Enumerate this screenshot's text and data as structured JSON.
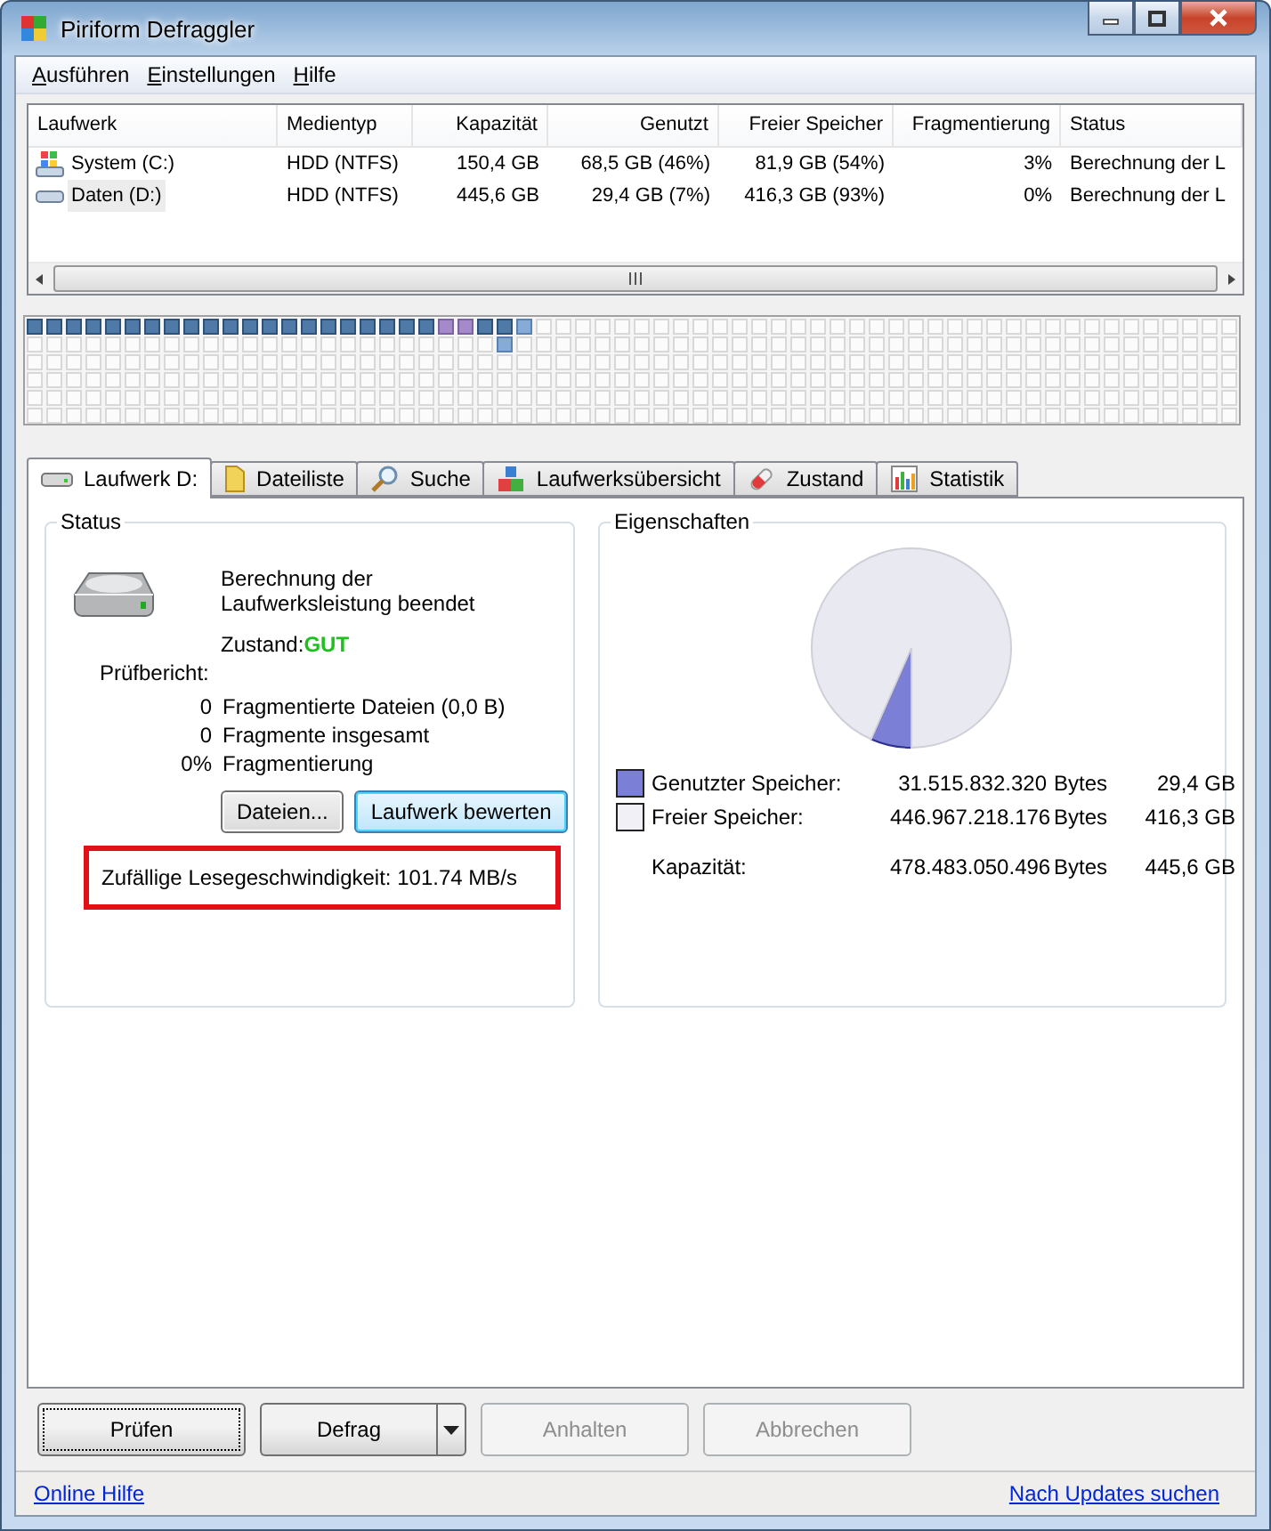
{
  "window": {
    "title": "Piriform Defraggler"
  },
  "menu": [
    {
      "label": "Ausführen"
    },
    {
      "label": "Einstellungen"
    },
    {
      "label": "Hilfe"
    }
  ],
  "drives": {
    "columns": [
      {
        "label": "Laufwerk"
      },
      {
        "label": "Medientyp"
      },
      {
        "label": "Kapazität"
      },
      {
        "label": "Genutzt"
      },
      {
        "label": "Freier Speicher"
      },
      {
        "label": "Fragmentierung"
      },
      {
        "label": "Status"
      }
    ],
    "rows": [
      {
        "kind": "system",
        "selected": false,
        "cells": [
          "System (C:)",
          "HDD (NTFS)",
          "150,4 GB",
          "68,5 GB (46%)",
          "81,9 GB (54%)",
          "3%",
          "Berechnung der L"
        ]
      },
      {
        "kind": "data",
        "selected": true,
        "cells": [
          "Daten (D:)",
          "HDD (NTFS)",
          "445,6 GB",
          "29,4 GB (7%)",
          "416,3 GB (93%)",
          "0%",
          "Berechnung der L"
        ]
      }
    ]
  },
  "cluster_map": {
    "rows": [
      {
        "blocks": [
          {
            "kind": "used"
          },
          {
            "kind": "used"
          },
          {
            "kind": "used"
          },
          {
            "kind": "used"
          },
          {
            "kind": "used"
          },
          {
            "kind": "used"
          },
          {
            "kind": "used"
          },
          {
            "kind": "used"
          },
          {
            "kind": "used"
          },
          {
            "kind": "used"
          },
          {
            "kind": "used"
          },
          {
            "kind": "used"
          },
          {
            "kind": "used"
          },
          {
            "kind": "used"
          },
          {
            "kind": "used"
          },
          {
            "kind": "used"
          },
          {
            "kind": "used"
          },
          {
            "kind": "used"
          },
          {
            "kind": "used"
          },
          {
            "kind": "used"
          },
          {
            "kind": "used"
          },
          {
            "kind": "fragmented"
          },
          {
            "kind": "fragmented"
          },
          {
            "kind": "used"
          },
          {
            "kind": "used"
          },
          {
            "kind": "current"
          },
          {
            "kind": "free"
          },
          {
            "kind": "free"
          },
          {
            "kind": "free"
          },
          {
            "kind": "free"
          },
          {
            "kind": "free"
          },
          {
            "kind": "free"
          },
          {
            "kind": "free"
          },
          {
            "kind": "free"
          },
          {
            "kind": "free"
          },
          {
            "kind": "free"
          },
          {
            "kind": "free"
          },
          {
            "kind": "free"
          },
          {
            "kind": "free"
          },
          {
            "kind": "free"
          },
          {
            "kind": "free"
          },
          {
            "kind": "free"
          },
          {
            "kind": "free"
          },
          {
            "kind": "free"
          },
          {
            "kind": "free"
          },
          {
            "kind": "free"
          },
          {
            "kind": "free"
          },
          {
            "kind": "free"
          },
          {
            "kind": "free"
          },
          {
            "kind": "free"
          },
          {
            "kind": "free"
          },
          {
            "kind": "free"
          },
          {
            "kind": "free"
          },
          {
            "kind": "free"
          },
          {
            "kind": "free"
          },
          {
            "kind": "free"
          },
          {
            "kind": "free"
          },
          {
            "kind": "free"
          },
          {
            "kind": "free"
          },
          {
            "kind": "free"
          },
          {
            "kind": "free"
          },
          {
            "kind": "free"
          }
        ]
      },
      {
        "blocks": [
          {
            "kind": "free"
          },
          {
            "kind": "free"
          },
          {
            "kind": "free"
          },
          {
            "kind": "free"
          },
          {
            "kind": "free"
          },
          {
            "kind": "free"
          },
          {
            "kind": "free"
          },
          {
            "kind": "free"
          },
          {
            "kind": "free"
          },
          {
            "kind": "free"
          },
          {
            "kind": "free"
          },
          {
            "kind": "free"
          },
          {
            "kind": "free"
          },
          {
            "kind": "free"
          },
          {
            "kind": "free"
          },
          {
            "kind": "free"
          },
          {
            "kind": "free"
          },
          {
            "kind": "free"
          },
          {
            "kind": "free"
          },
          {
            "kind": "free"
          },
          {
            "kind": "free"
          },
          {
            "kind": "free"
          },
          {
            "kind": "free"
          },
          {
            "kind": "free"
          },
          {
            "kind": "current"
          },
          {
            "kind": "free"
          },
          {
            "kind": "free"
          },
          {
            "kind": "free"
          },
          {
            "kind": "free"
          },
          {
            "kind": "free"
          },
          {
            "kind": "free"
          },
          {
            "kind": "free"
          },
          {
            "kind": "free"
          },
          {
            "kind": "free"
          },
          {
            "kind": "free"
          },
          {
            "kind": "free"
          },
          {
            "kind": "free"
          },
          {
            "kind": "free"
          },
          {
            "kind": "free"
          },
          {
            "kind": "free"
          },
          {
            "kind": "free"
          },
          {
            "kind": "free"
          },
          {
            "kind": "free"
          },
          {
            "kind": "free"
          },
          {
            "kind": "free"
          },
          {
            "kind": "free"
          },
          {
            "kind": "free"
          },
          {
            "kind": "free"
          },
          {
            "kind": "free"
          },
          {
            "kind": "free"
          },
          {
            "kind": "free"
          },
          {
            "kind": "free"
          },
          {
            "kind": "free"
          },
          {
            "kind": "free"
          },
          {
            "kind": "free"
          },
          {
            "kind": "free"
          },
          {
            "kind": "free"
          },
          {
            "kind": "free"
          },
          {
            "kind": "free"
          },
          {
            "kind": "free"
          },
          {
            "kind": "free"
          },
          {
            "kind": "free"
          }
        ]
      },
      {
        "blocks": [
          {
            "kind": "free"
          },
          {
            "kind": "free"
          },
          {
            "kind": "free"
          },
          {
            "kind": "free"
          },
          {
            "kind": "free"
          },
          {
            "kind": "free"
          },
          {
            "kind": "free"
          },
          {
            "kind": "free"
          },
          {
            "kind": "free"
          },
          {
            "kind": "free"
          },
          {
            "kind": "free"
          },
          {
            "kind": "free"
          },
          {
            "kind": "free"
          },
          {
            "kind": "free"
          },
          {
            "kind": "free"
          },
          {
            "kind": "free"
          },
          {
            "kind": "free"
          },
          {
            "kind": "free"
          },
          {
            "kind": "free"
          },
          {
            "kind": "free"
          },
          {
            "kind": "free"
          },
          {
            "kind": "free"
          },
          {
            "kind": "free"
          },
          {
            "kind": "free"
          },
          {
            "kind": "free"
          },
          {
            "kind": "free"
          },
          {
            "kind": "free"
          },
          {
            "kind": "free"
          },
          {
            "kind": "free"
          },
          {
            "kind": "free"
          },
          {
            "kind": "free"
          },
          {
            "kind": "free"
          },
          {
            "kind": "free"
          },
          {
            "kind": "free"
          },
          {
            "kind": "free"
          },
          {
            "kind": "free"
          },
          {
            "kind": "free"
          },
          {
            "kind": "free"
          },
          {
            "kind": "free"
          },
          {
            "kind": "free"
          },
          {
            "kind": "free"
          },
          {
            "kind": "free"
          },
          {
            "kind": "free"
          },
          {
            "kind": "free"
          },
          {
            "kind": "free"
          },
          {
            "kind": "free"
          },
          {
            "kind": "free"
          },
          {
            "kind": "free"
          },
          {
            "kind": "free"
          },
          {
            "kind": "free"
          },
          {
            "kind": "free"
          },
          {
            "kind": "free"
          },
          {
            "kind": "free"
          },
          {
            "kind": "free"
          },
          {
            "kind": "free"
          },
          {
            "kind": "free"
          },
          {
            "kind": "free"
          },
          {
            "kind": "free"
          },
          {
            "kind": "free"
          },
          {
            "kind": "free"
          },
          {
            "kind": "free"
          },
          {
            "kind": "free"
          }
        ]
      },
      {
        "blocks": [
          {
            "kind": "free"
          },
          {
            "kind": "free"
          },
          {
            "kind": "free"
          },
          {
            "kind": "free"
          },
          {
            "kind": "free"
          },
          {
            "kind": "free"
          },
          {
            "kind": "free"
          },
          {
            "kind": "free"
          },
          {
            "kind": "free"
          },
          {
            "kind": "free"
          },
          {
            "kind": "free"
          },
          {
            "kind": "free"
          },
          {
            "kind": "free"
          },
          {
            "kind": "free"
          },
          {
            "kind": "free"
          },
          {
            "kind": "free"
          },
          {
            "kind": "free"
          },
          {
            "kind": "free"
          },
          {
            "kind": "free"
          },
          {
            "kind": "free"
          },
          {
            "kind": "free"
          },
          {
            "kind": "free"
          },
          {
            "kind": "free"
          },
          {
            "kind": "free"
          },
          {
            "kind": "free"
          },
          {
            "kind": "free"
          },
          {
            "kind": "free"
          },
          {
            "kind": "free"
          },
          {
            "kind": "free"
          },
          {
            "kind": "free"
          },
          {
            "kind": "free"
          },
          {
            "kind": "free"
          },
          {
            "kind": "free"
          },
          {
            "kind": "free"
          },
          {
            "kind": "free"
          },
          {
            "kind": "free"
          },
          {
            "kind": "free"
          },
          {
            "kind": "free"
          },
          {
            "kind": "free"
          },
          {
            "kind": "free"
          },
          {
            "kind": "free"
          },
          {
            "kind": "free"
          },
          {
            "kind": "free"
          },
          {
            "kind": "free"
          },
          {
            "kind": "free"
          },
          {
            "kind": "free"
          },
          {
            "kind": "free"
          },
          {
            "kind": "free"
          },
          {
            "kind": "free"
          },
          {
            "kind": "free"
          },
          {
            "kind": "free"
          },
          {
            "kind": "free"
          },
          {
            "kind": "free"
          },
          {
            "kind": "free"
          },
          {
            "kind": "free"
          },
          {
            "kind": "free"
          },
          {
            "kind": "free"
          },
          {
            "kind": "free"
          },
          {
            "kind": "free"
          },
          {
            "kind": "free"
          },
          {
            "kind": "free"
          },
          {
            "kind": "free"
          }
        ]
      },
      {
        "blocks": [
          {
            "kind": "free"
          },
          {
            "kind": "free"
          },
          {
            "kind": "free"
          },
          {
            "kind": "free"
          },
          {
            "kind": "free"
          },
          {
            "kind": "free"
          },
          {
            "kind": "free"
          },
          {
            "kind": "free"
          },
          {
            "kind": "free"
          },
          {
            "kind": "free"
          },
          {
            "kind": "free"
          },
          {
            "kind": "free"
          },
          {
            "kind": "free"
          },
          {
            "kind": "free"
          },
          {
            "kind": "free"
          },
          {
            "kind": "free"
          },
          {
            "kind": "free"
          },
          {
            "kind": "free"
          },
          {
            "kind": "free"
          },
          {
            "kind": "free"
          },
          {
            "kind": "free"
          },
          {
            "kind": "free"
          },
          {
            "kind": "free"
          },
          {
            "kind": "free"
          },
          {
            "kind": "free"
          },
          {
            "kind": "free"
          },
          {
            "kind": "free"
          },
          {
            "kind": "free"
          },
          {
            "kind": "free"
          },
          {
            "kind": "free"
          },
          {
            "kind": "free"
          },
          {
            "kind": "free"
          },
          {
            "kind": "free"
          },
          {
            "kind": "free"
          },
          {
            "kind": "free"
          },
          {
            "kind": "free"
          },
          {
            "kind": "free"
          },
          {
            "kind": "free"
          },
          {
            "kind": "free"
          },
          {
            "kind": "free"
          },
          {
            "kind": "free"
          },
          {
            "kind": "free"
          },
          {
            "kind": "free"
          },
          {
            "kind": "free"
          },
          {
            "kind": "free"
          },
          {
            "kind": "free"
          },
          {
            "kind": "free"
          },
          {
            "kind": "free"
          },
          {
            "kind": "free"
          },
          {
            "kind": "free"
          },
          {
            "kind": "free"
          },
          {
            "kind": "free"
          },
          {
            "kind": "free"
          },
          {
            "kind": "free"
          },
          {
            "kind": "free"
          },
          {
            "kind": "free"
          },
          {
            "kind": "free"
          },
          {
            "kind": "free"
          },
          {
            "kind": "free"
          },
          {
            "kind": "free"
          },
          {
            "kind": "free"
          },
          {
            "kind": "free"
          }
        ]
      },
      {
        "blocks": [
          {
            "kind": "free"
          },
          {
            "kind": "free"
          },
          {
            "kind": "free"
          },
          {
            "kind": "free"
          },
          {
            "kind": "free"
          },
          {
            "kind": "free"
          },
          {
            "kind": "free"
          },
          {
            "kind": "free"
          },
          {
            "kind": "free"
          },
          {
            "kind": "free"
          },
          {
            "kind": "free"
          },
          {
            "kind": "free"
          },
          {
            "kind": "free"
          },
          {
            "kind": "free"
          },
          {
            "kind": "free"
          },
          {
            "kind": "free"
          },
          {
            "kind": "free"
          },
          {
            "kind": "free"
          },
          {
            "kind": "free"
          },
          {
            "kind": "free"
          },
          {
            "kind": "free"
          },
          {
            "kind": "free"
          },
          {
            "kind": "free"
          },
          {
            "kind": "free"
          },
          {
            "kind": "free"
          },
          {
            "kind": "free"
          },
          {
            "kind": "free"
          },
          {
            "kind": "free"
          },
          {
            "kind": "free"
          },
          {
            "kind": "free"
          },
          {
            "kind": "free"
          },
          {
            "kind": "free"
          },
          {
            "kind": "free"
          },
          {
            "kind": "free"
          },
          {
            "kind": "free"
          },
          {
            "kind": "free"
          },
          {
            "kind": "free"
          },
          {
            "kind": "free"
          },
          {
            "kind": "free"
          },
          {
            "kind": "free"
          },
          {
            "kind": "free"
          },
          {
            "kind": "free"
          },
          {
            "kind": "free"
          },
          {
            "kind": "free"
          },
          {
            "kind": "free"
          },
          {
            "kind": "free"
          },
          {
            "kind": "free"
          },
          {
            "kind": "free"
          },
          {
            "kind": "free"
          },
          {
            "kind": "free"
          },
          {
            "kind": "free"
          },
          {
            "kind": "free"
          },
          {
            "kind": "free"
          },
          {
            "kind": "free"
          },
          {
            "kind": "free"
          },
          {
            "kind": "free"
          },
          {
            "kind": "free"
          },
          {
            "kind": "free"
          },
          {
            "kind": "free"
          },
          {
            "kind": "free"
          },
          {
            "kind": "free"
          },
          {
            "kind": "free"
          }
        ]
      }
    ]
  },
  "tabs": [
    {
      "label": "Laufwerk D:",
      "kind": "drive",
      "selected": true
    },
    {
      "label": "Dateiliste",
      "kind": "folder",
      "selected": false
    },
    {
      "label": "Suche",
      "kind": "search",
      "selected": false
    },
    {
      "label": "Laufwerksübersicht",
      "kind": "blocks",
      "selected": false
    },
    {
      "label": "Zustand",
      "kind": "health",
      "selected": false
    },
    {
      "label": "Statistik",
      "kind": "stats",
      "selected": false
    }
  ],
  "status": {
    "title": "Status",
    "message": "Berechnung der Laufwerksleistung beendet",
    "health_label": "Zustand:",
    "health_value": "GUT",
    "report_label": "Prüfbericht:",
    "report_values": [
      "0",
      "0",
      "0%"
    ],
    "report_labels": [
      "Fragmentierte Dateien (0,0 B)",
      "Fragmente insgesamt",
      "Fragmentierung"
    ],
    "buttons": [
      {
        "label": "Dateien...",
        "default": false
      },
      {
        "label": "Laufwerk bewerten",
        "default": true
      }
    ],
    "speed": "Zufällige Lesegeschwindigkeit: 101.74 MB/s"
  },
  "properties": {
    "title": "Eigenschaften",
    "chart_data": {
      "type": "pie",
      "values": [
        6.6,
        93.4
      ]
    },
    "legend": [
      {
        "label": "Genutzter Speicher:",
        "bytes": "31.515.832.320",
        "unit": "Bytes",
        "size": "29,4 GB",
        "color": "#7b7fd6"
      },
      {
        "label": "Freier Speicher:",
        "bytes": "446.967.218.176",
        "unit": "Bytes",
        "size": "416,3 GB",
        "color": "#f0f0f6"
      },
      {
        "label": "Kapazität:",
        "bytes": "478.483.050.496",
        "unit": "Bytes",
        "size": "445,6 GB"
      }
    ]
  },
  "actions": [
    {
      "label": "Prüfen",
      "kind": "focused",
      "disabled": false
    },
    {
      "label": "Defrag",
      "kind": "split",
      "disabled": false
    },
    {
      "label": "Anhalten",
      "kind": "plain",
      "disabled": true
    },
    {
      "label": "Abbrechen",
      "kind": "plain",
      "disabled": true
    }
  ],
  "footer": {
    "links": [
      {
        "label": "Online Hilfe"
      },
      {
        "label": "Nach Updates suchen"
      }
    ]
  }
}
